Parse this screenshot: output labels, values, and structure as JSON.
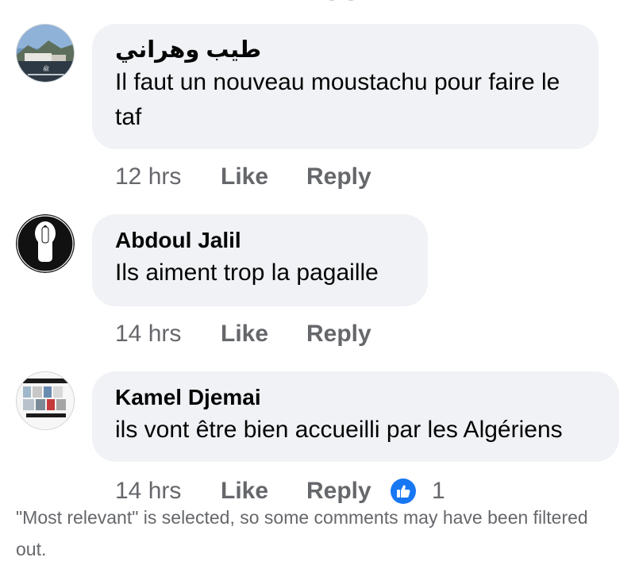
{
  "comments": [
    {
      "author": "طيب وهراني",
      "text": "Il faut un nouveau moustachu pour faire le taf",
      "time": "12 hrs",
      "like_label": "Like",
      "reply_label": "Reply"
    },
    {
      "author": "Abdoul Jalil",
      "text": "Ils aiment trop la pagaille",
      "time": "14 hrs",
      "like_label": "Like",
      "reply_label": "Reply"
    },
    {
      "author": "Kamel Djemai",
      "text": "ils vont être bien accueilli par les Algériens",
      "time": "14 hrs",
      "like_label": "Like",
      "reply_label": "Reply",
      "reaction_count": "1"
    }
  ],
  "footer_note": "\"Most relevant\" is selected, so some comments may have been filtered out.",
  "colors": {
    "bubble": "#f0f2f5",
    "secondary_text": "#65676b",
    "like_blue": "#1877f2"
  }
}
